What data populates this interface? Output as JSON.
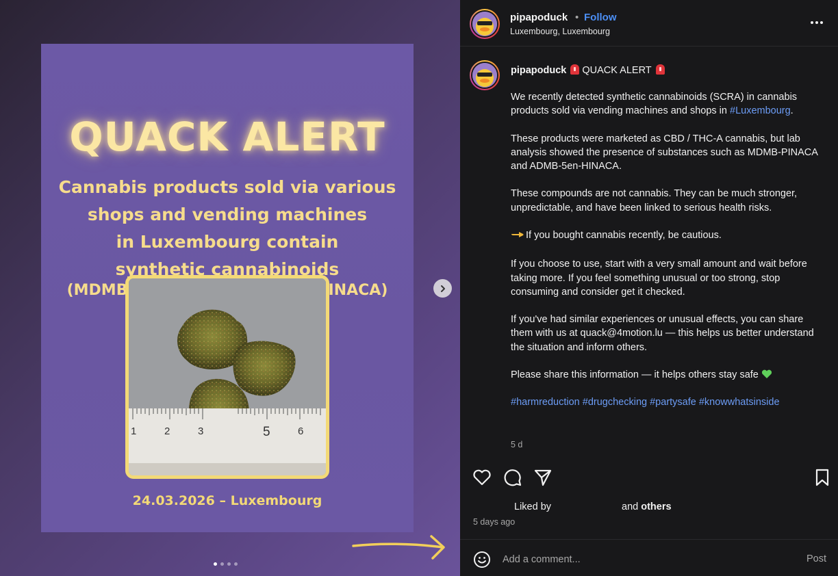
{
  "media": {
    "card_title": "QUACK ALERT",
    "card_lines": [
      "Cannabis products sold via various",
      "shops and vending machines",
      "in Luxembourg contain",
      "synthetic cannabinoids"
    ],
    "card_chemicals": "(MDMB-PINACA & ADMB-5en-HINACA)",
    "card_date": "24.03.2026 – Luxembourg",
    "ruler_numbers": [
      "1",
      "2",
      "3",
      "5",
      "6"
    ],
    "slide_count": 4,
    "active_slide": 1
  },
  "header": {
    "username": "pipapoduck",
    "separator": "•",
    "follow_label": "Follow",
    "location": "Luxembourg, Luxembourg"
  },
  "caption": {
    "username": "pipapoduck",
    "headline": "QUACK ALERT",
    "p1_text": "We recently detected synthetic cannabinoids (SCRA) in cannabis products sold via vending machines and shops in ",
    "p1_link": "#Luxembourg",
    "p1_tail": ".",
    "p2": "These products were marketed as CBD / THC-A cannabis, but lab analysis showed the presence of substances such as MDMB-PINACA and ADMB-5en-HINACA.",
    "p3": "These compounds are not cannabis. They can be much stronger, unpredictable, and have been linked to serious health risks.",
    "p4": "If you bought cannabis recently, be cautious.",
    "p5": "If you choose to use, start with a very small amount and wait before taking more. If you feel something unusual or too strong, stop consuming and consider get it checked.",
    "p6": "If you've had similar experiences or unusual effects, you can share them with us at quack@4motion.lu — this helps us better understand the situation and inform others.",
    "p7": "Please share this information — it helps others stay safe",
    "hashtags": "#harmreduction #drugchecking #partysafe #knowwhatsinside",
    "age": "5 d"
  },
  "engagement": {
    "liked_by": "Liked by",
    "and_label": "and",
    "others_label": "others",
    "days_ago": "5 days ago"
  },
  "comment": {
    "placeholder": "Add a comment...",
    "post_label": "Post"
  },
  "colors": {
    "card_purple": "#6c59a6",
    "title_glow": "#fbe7a4",
    "accent_yellow": "#f3d977",
    "link_blue": "#6c9cf5",
    "follow_blue": "#4c8ff6",
    "panel_bg": "#18181a"
  },
  "icons": [
    "chevron-right-icon",
    "more-icon",
    "alarm-icon",
    "pointing-hand-icon",
    "green-heart-icon",
    "like-heart-icon",
    "comment-icon",
    "share-icon",
    "bookmark-icon",
    "emoji-icon",
    "arrow-decoration"
  ]
}
